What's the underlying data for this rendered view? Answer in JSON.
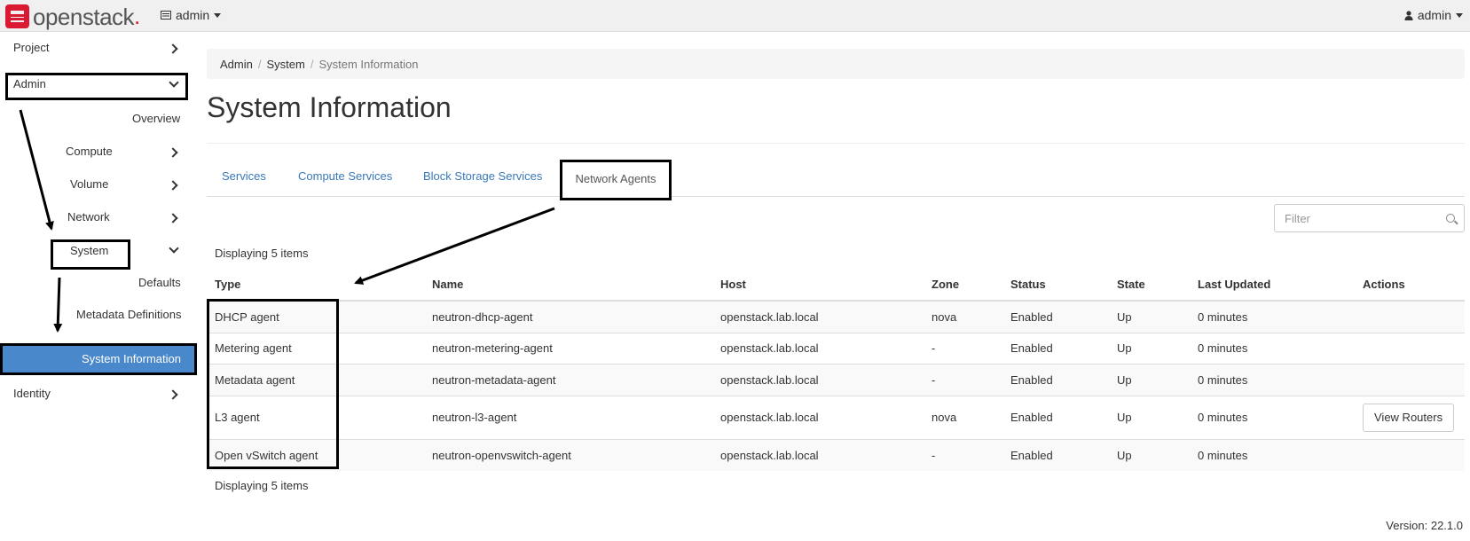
{
  "topbar": {
    "brand": "openstack",
    "project_label": "admin",
    "user_label": "admin"
  },
  "sidebar": {
    "project": "Project",
    "admin": "Admin",
    "overview": "Overview",
    "compute": "Compute",
    "volume": "Volume",
    "network": "Network",
    "system": "System",
    "defaults": "Defaults",
    "metadata_definitions": "Metadata Definitions",
    "system_information": "System Information",
    "identity": "Identity"
  },
  "breadcrumb": {
    "items": [
      "Admin",
      "System",
      "System Information"
    ]
  },
  "page": {
    "title": "System Information"
  },
  "tabs": [
    {
      "label": "Services"
    },
    {
      "label": "Compute Services"
    },
    {
      "label": "Block Storage Services"
    },
    {
      "label": "Network Agents"
    }
  ],
  "filter": {
    "placeholder": "Filter"
  },
  "table": {
    "count_text": "Displaying 5 items",
    "columns": [
      "Type",
      "Name",
      "Host",
      "Zone",
      "Status",
      "State",
      "Last Updated",
      "Actions"
    ],
    "rows": [
      {
        "type": "DHCP agent",
        "name": "neutron-dhcp-agent",
        "host": "openstack.lab.local",
        "zone": "nova",
        "status": "Enabled",
        "state": "Up",
        "updated": "0 minutes",
        "action": ""
      },
      {
        "type": "Metering agent",
        "name": "neutron-metering-agent",
        "host": "openstack.lab.local",
        "zone": "-",
        "status": "Enabled",
        "state": "Up",
        "updated": "0 minutes",
        "action": ""
      },
      {
        "type": "Metadata agent",
        "name": "neutron-metadata-agent",
        "host": "openstack.lab.local",
        "zone": "-",
        "status": "Enabled",
        "state": "Up",
        "updated": "0 minutes",
        "action": ""
      },
      {
        "type": "L3 agent",
        "name": "neutron-l3-agent",
        "host": "openstack.lab.local",
        "zone": "nova",
        "status": "Enabled",
        "state": "Up",
        "updated": "0 minutes",
        "action": "View Routers"
      },
      {
        "type": "Open vSwitch agent",
        "name": "neutron-openvswitch-agent",
        "host": "openstack.lab.local",
        "zone": "-",
        "status": "Enabled",
        "state": "Up",
        "updated": "0 minutes",
        "action": ""
      }
    ]
  },
  "footer": {
    "version": "Version: 22.1.0"
  },
  "colors": {
    "accent": "#4a88cc",
    "link": "#3878b8",
    "brand_red": "#da1a32"
  }
}
